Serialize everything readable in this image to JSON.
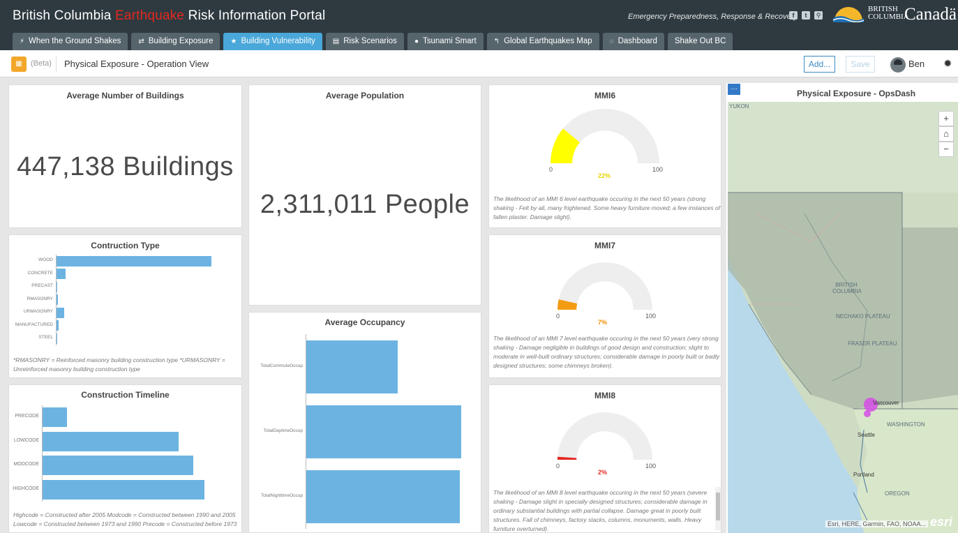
{
  "header": {
    "title_part1": "British Columbia ",
    "title_accent": "Earthquake",
    "title_part2": " Risk Information Portal",
    "tagline": "Emergency Preparedness, Response & Recovery",
    "gov_name_line1": "BRITISH",
    "gov_name_line2": "COLUMBIA",
    "canada": "Canadä"
  },
  "tabs": [
    {
      "label": "When the Ground Shakes",
      "icon": "lightning-icon",
      "glyph": "⚡",
      "active": false
    },
    {
      "label": "Building Exposure",
      "icon": "link-icon",
      "glyph": "⇄",
      "active": false
    },
    {
      "label": "Building Vulnerability",
      "icon": "star-icon",
      "glyph": "★",
      "active": true
    },
    {
      "label": "Risk Scenarios",
      "icon": "document-icon",
      "glyph": "▤",
      "active": false
    },
    {
      "label": "Tsunami Smart",
      "icon": "lightbulb-icon",
      "glyph": "●",
      "active": false
    },
    {
      "label": "Global Earthquakes Map",
      "icon": "signpost-icon",
      "glyph": "↰",
      "active": false
    },
    {
      "label": "Dashboard",
      "icon": "refresh-icon",
      "glyph": "◌",
      "active": false
    },
    {
      "label": "Shake Out BC",
      "icon": "",
      "glyph": "",
      "active": false
    }
  ],
  "appbar": {
    "beta": "(Beta)",
    "title": "Physical Exposure - Operation View",
    "add_label": "Add...",
    "save_label": "Save",
    "user": "Ben"
  },
  "buildings": {
    "title": "Average Number of Buildings",
    "value": "447,138 Buildings"
  },
  "population": {
    "title": "Average Population",
    "value": "2,311,011 People"
  },
  "construction_type": {
    "title": "Contruction Type",
    "note": "*RMASONRY = Reinforced masonry building construction type *URMASONRY = Unreinforced masonry building construction type"
  },
  "construction_timeline": {
    "title": "Construction Timeline",
    "note": "Highcode = Constructed after 2005 Modcode = Constructed between 1990 and 2005 Lowcode = Constructed between 1973 and 1990 Precode = Constructed before 1973"
  },
  "occupancy": {
    "title": "Average Occupancy"
  },
  "gauges": [
    {
      "title": "MMI6",
      "min": "0",
      "max": "100",
      "value": 22,
      "label": "22%",
      "color": "#ffff00",
      "label_color": "#e6d600",
      "note": "The likelihood of an MMI 6 level earthquake occuring in the next 50 years (strong shaking - Felt by all, many frightened. Some heavy furniture moved; a few instances of fallen plaster. Damage slight)."
    },
    {
      "title": "MMI7",
      "min": "0",
      "max": "100",
      "value": 7,
      "label": "7%",
      "color": "#f39c12",
      "label_color": "#f08c00",
      "note": "The likelihood of an MMI 7 level earthquake occuring in the next 50 years (very strong shaking - Damage negligible in buildings of good design and construction; slight to moderate in well-built ordinary structures; considerable damage in poorly built or badly designed structures; some chimneys broken)."
    },
    {
      "title": "MMI8",
      "min": "0",
      "max": "100",
      "value": 2,
      "label": "2%",
      "color": "#e3281f",
      "label_color": "#e3281f",
      "note": "The likelihood of an MMI 8 level earthquake occuring in the next 50 years (severe shaking - Damage slight in specially designed structures; considerable damage in ordinary substantial buildings with partial collapse. Damage great in poorly built structures. Fall of chimneys, factory stacks, columns, monuments, walls. Heavy furniture overturned)."
    }
  ],
  "map": {
    "title": "Physical Exposure - OpsDash",
    "attribution": "Esri, HERE, Garmin, FAO, NOAA...",
    "esri": "esri",
    "labels": [
      "YUKON",
      "BRITISH COLUMBIA",
      "NECHAKO PLATEAU",
      "FRASER PLATEAU",
      "Vancouver",
      "Seattle",
      "WASHINGTON",
      "Portland",
      "OREGON"
    ]
  },
  "chart_data": [
    {
      "type": "bar",
      "orientation": "horizontal",
      "title": "Contruction Type",
      "categories": [
        "WOOD",
        "CONCRETE",
        "PRECAST",
        "RMASONRY",
        "URMASONRY",
        "MANUFACTURED",
        "STEEL"
      ],
      "values": [
        100,
        6,
        0.5,
        1,
        5,
        1.5,
        0.5
      ]
    },
    {
      "type": "bar",
      "orientation": "horizontal",
      "title": "Construction Timeline",
      "categories": [
        "PRECODE",
        "LOWCODE",
        "MODCODE",
        "HIGHCODE"
      ],
      "values": [
        15,
        83,
        92,
        99
      ]
    },
    {
      "type": "bar",
      "orientation": "horizontal",
      "title": "Average Occupancy",
      "categories": [
        "TotalCommuteOccup",
        "TotalDaytimeOccup",
        "TotalNighttimeOccup"
      ],
      "values": [
        59,
        100,
        99
      ]
    }
  ]
}
